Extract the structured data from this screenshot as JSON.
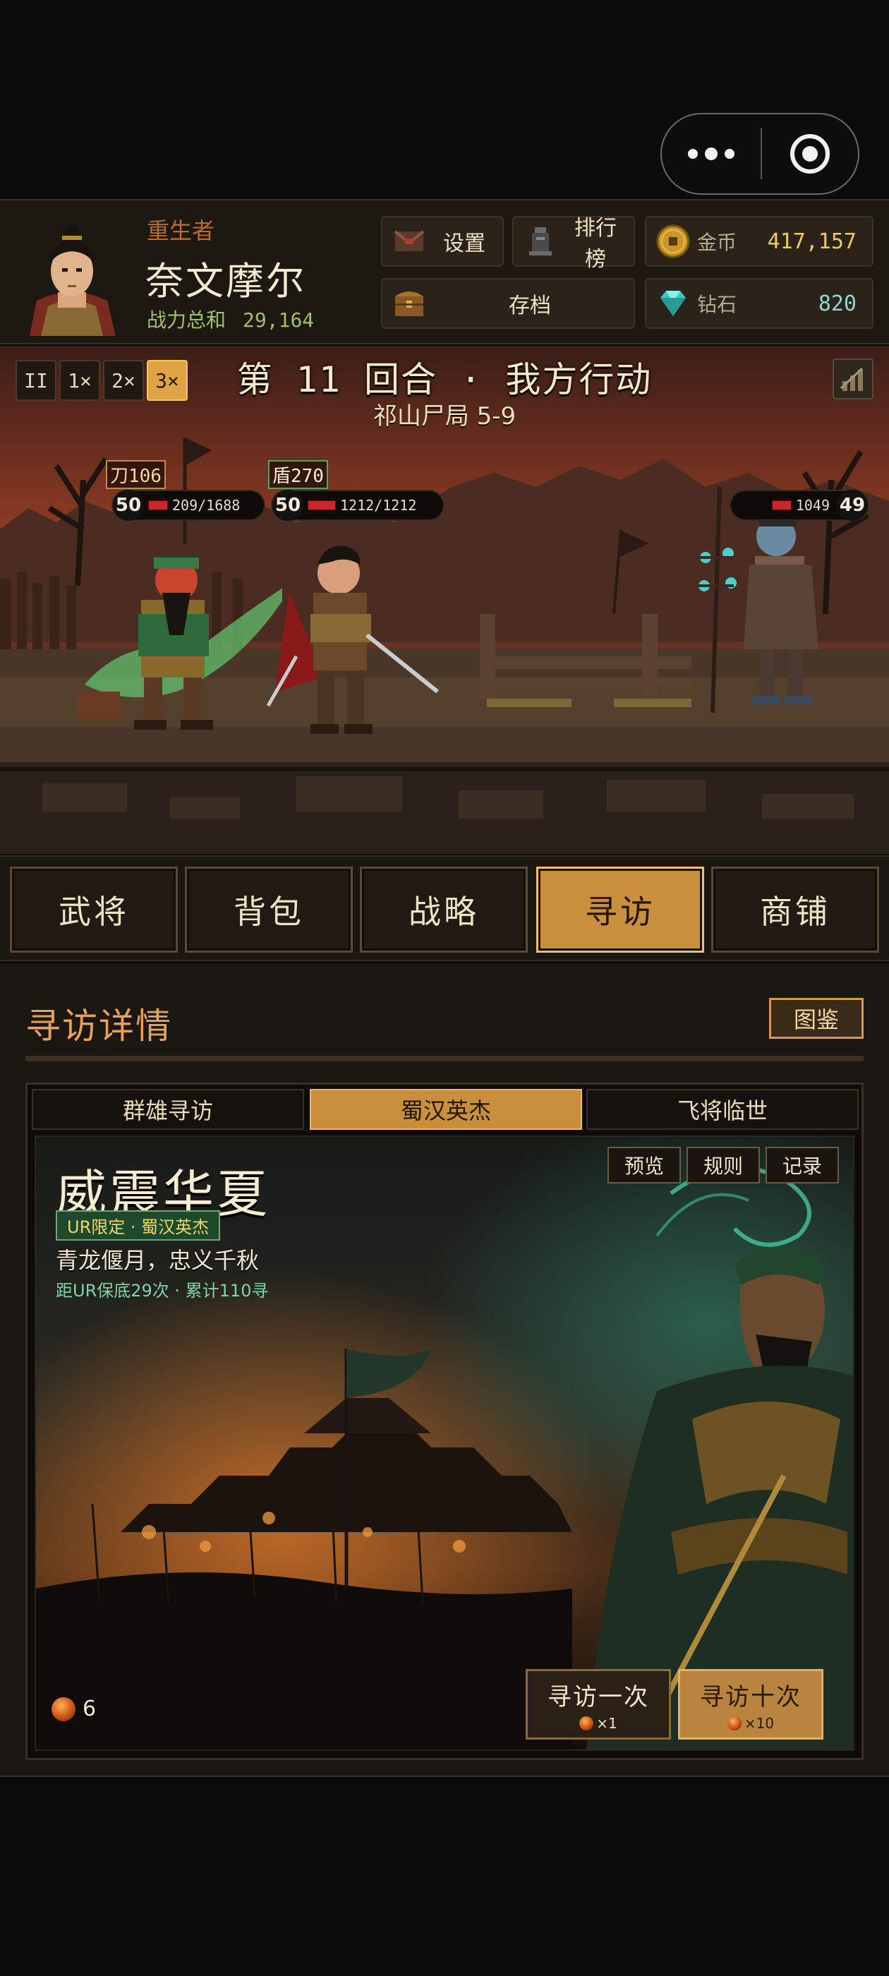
{
  "player": {
    "tag": "重生者",
    "name": "奈文摩尔",
    "power_label": "战力总和",
    "power_value": "29,164"
  },
  "header_buttons": {
    "settings": "设置",
    "ranking": "排行榜",
    "save": "存档"
  },
  "resources": {
    "gold_label": "金币",
    "gold_value": "417,157",
    "diamond_label": "钻石",
    "diamond_value": "820"
  },
  "battle": {
    "speeds": [
      "II",
      "1×",
      "2×",
      "3×"
    ],
    "active_speed": "3×",
    "round_title": "第 11 回合 · 我方行动",
    "stage": "祁山尸局 5-9",
    "units": {
      "ally1": {
        "tag": "刀106",
        "level": "50",
        "hp": "209/1688"
      },
      "ally2": {
        "tag": "盾270",
        "level": "50",
        "hp": "1212/1212"
      },
      "enemy1": {
        "level": "49",
        "hp": "1049"
      }
    }
  },
  "tabs": [
    "武将",
    "背包",
    "战略",
    "寻访",
    "商铺"
  ],
  "active_tab": "寻访",
  "recruit": {
    "section_title": "寻访详情",
    "codex_label": "图鉴",
    "subtabs": [
      "群雄寻访",
      "蜀汉英杰",
      "飞将临世"
    ],
    "active_subtab": "蜀汉英杰",
    "banner": {
      "title": "威震华夏",
      "badge": "UR限定 · 蜀汉英杰",
      "subtitle": "青龙偃月，忠义千秋",
      "pity": "距UR保底29次 · 累计110寻",
      "buttons": {
        "preview": "预览",
        "rules": "规则",
        "records": "记录"
      },
      "ticket_count": "6",
      "draw_one": {
        "label": "寻访一次",
        "cost": "×1"
      },
      "draw_ten": {
        "label": "寻访十次",
        "cost": "×10"
      }
    }
  },
  "colors": {
    "accent": "#c98f3c",
    "title_orange": "#e7a15a",
    "gold_text": "#f0c964",
    "green_text": "#9fc26b"
  }
}
